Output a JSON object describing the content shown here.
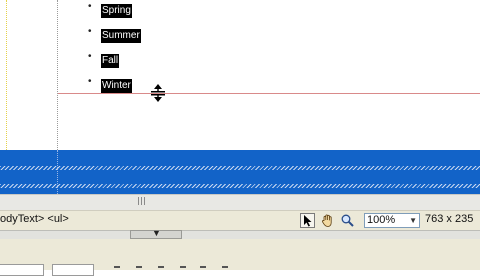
{
  "design_view": {
    "list_items": [
      "Spring",
      "Summer",
      "Fall",
      "Winter"
    ],
    "bullet": "•"
  },
  "status_bar": {
    "tag_selector": "odyText> <ul>",
    "zoom_value": "100%",
    "zoom_arrow": "▼",
    "dimensions": "763 x 235"
  },
  "icons": {
    "pointer": "pointer-tool-icon",
    "hand": "hand-tool-icon",
    "zoom": "zoom-tool-icon",
    "resize_cursor": "row-resize-cursor-icon",
    "panel_toggle": "triangle-down-icon"
  },
  "panel_toggle_glyph": "▼",
  "colors": {
    "selection": "#000000",
    "split_bar": "#1263c8",
    "guide": "#d98a8a"
  }
}
